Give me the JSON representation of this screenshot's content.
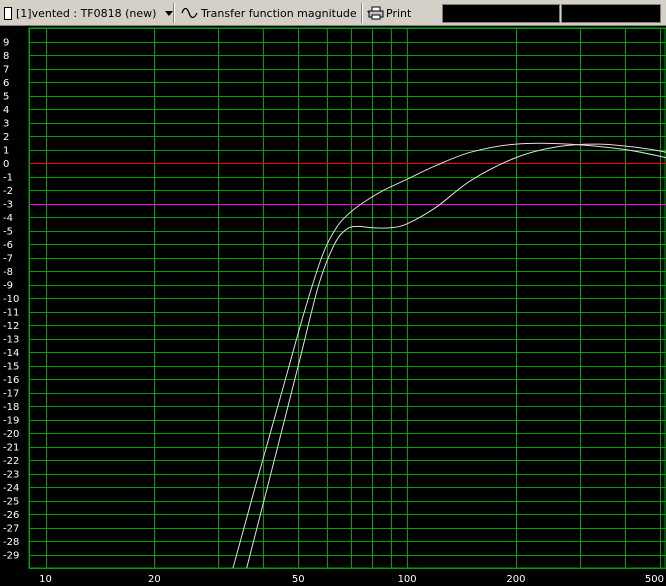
{
  "toolbar": {
    "document_label": "[1]vented : TF0818 (new)",
    "view_label": "Transfer function magnitude",
    "print_label": "Print"
  },
  "colors": {
    "background": "#000000",
    "grid": "#00a000",
    "reference_0db": "#ff0000",
    "reference_minus3db": "#ff00ff",
    "curve": "#e0e0e0"
  },
  "chart_data": {
    "type": "line",
    "title": "",
    "xlabel": "",
    "ylabel": "",
    "xscale": "log",
    "xlim": [
      9,
      520
    ],
    "ylim": [
      -30,
      10
    ],
    "grid": true,
    "x_ticks": [
      10,
      20,
      50,
      100,
      200,
      500
    ],
    "x_tick_labels": [
      "10",
      "20",
      "50",
      "100",
      "200",
      "500"
    ],
    "y_ticks": [
      9,
      8,
      7,
      6,
      5,
      4,
      3,
      2,
      1,
      0,
      -1,
      -2,
      -3,
      -4,
      -5,
      -6,
      -7,
      -8,
      -9,
      -10,
      -11,
      -12,
      -13,
      -14,
      -15,
      -16,
      -17,
      -18,
      -19,
      -20,
      -21,
      -22,
      -23,
      -24,
      -25,
      -26,
      -27,
      -28,
      -29
    ],
    "y_tick_labels": [
      "9",
      "8",
      "7",
      "6",
      "5",
      "4",
      "3",
      "2",
      "1",
      "0",
      "-1",
      "-2",
      "-3",
      "-4",
      "-5",
      "-6",
      "-7",
      "-8",
      "-9",
      "-10",
      "-11",
      "-12",
      "-13",
      "-14",
      "-15",
      "-16",
      "-17",
      "-18",
      "-19",
      "-20",
      "-21",
      "-22",
      "-23",
      "-24",
      "-25",
      "-26",
      "-27",
      "-28",
      "-29"
    ],
    "reference_lines": [
      {
        "y": 0,
        "color": "#ff0000"
      },
      {
        "y": -3,
        "color": "#ff00ff"
      }
    ],
    "series": [
      {
        "x": [
          33,
          38,
          45,
          52,
          58,
          63,
          68,
          75,
          85,
          100,
          120,
          150,
          200,
          280,
          400,
          520
        ],
        "y": [
          -30,
          -24,
          -17,
          -11,
          -7,
          -5,
          -3.9,
          -3,
          -2.1,
          -1.2,
          -0.2,
          0.8,
          1.4,
          1.4,
          1.0,
          0.4
        ]
      },
      {
        "x": [
          36,
          42,
          50,
          57,
          63,
          68,
          73,
          80,
          90,
          100,
          120,
          150,
          200,
          260,
          340,
          450,
          520
        ],
        "y": [
          -30,
          -23,
          -15,
          -9,
          -6,
          -4.9,
          -4.7,
          -4.8,
          -4.8,
          -4.5,
          -3.3,
          -1.3,
          0.4,
          1.2,
          1.4,
          1.1,
          0.8
        ]
      }
    ]
  }
}
